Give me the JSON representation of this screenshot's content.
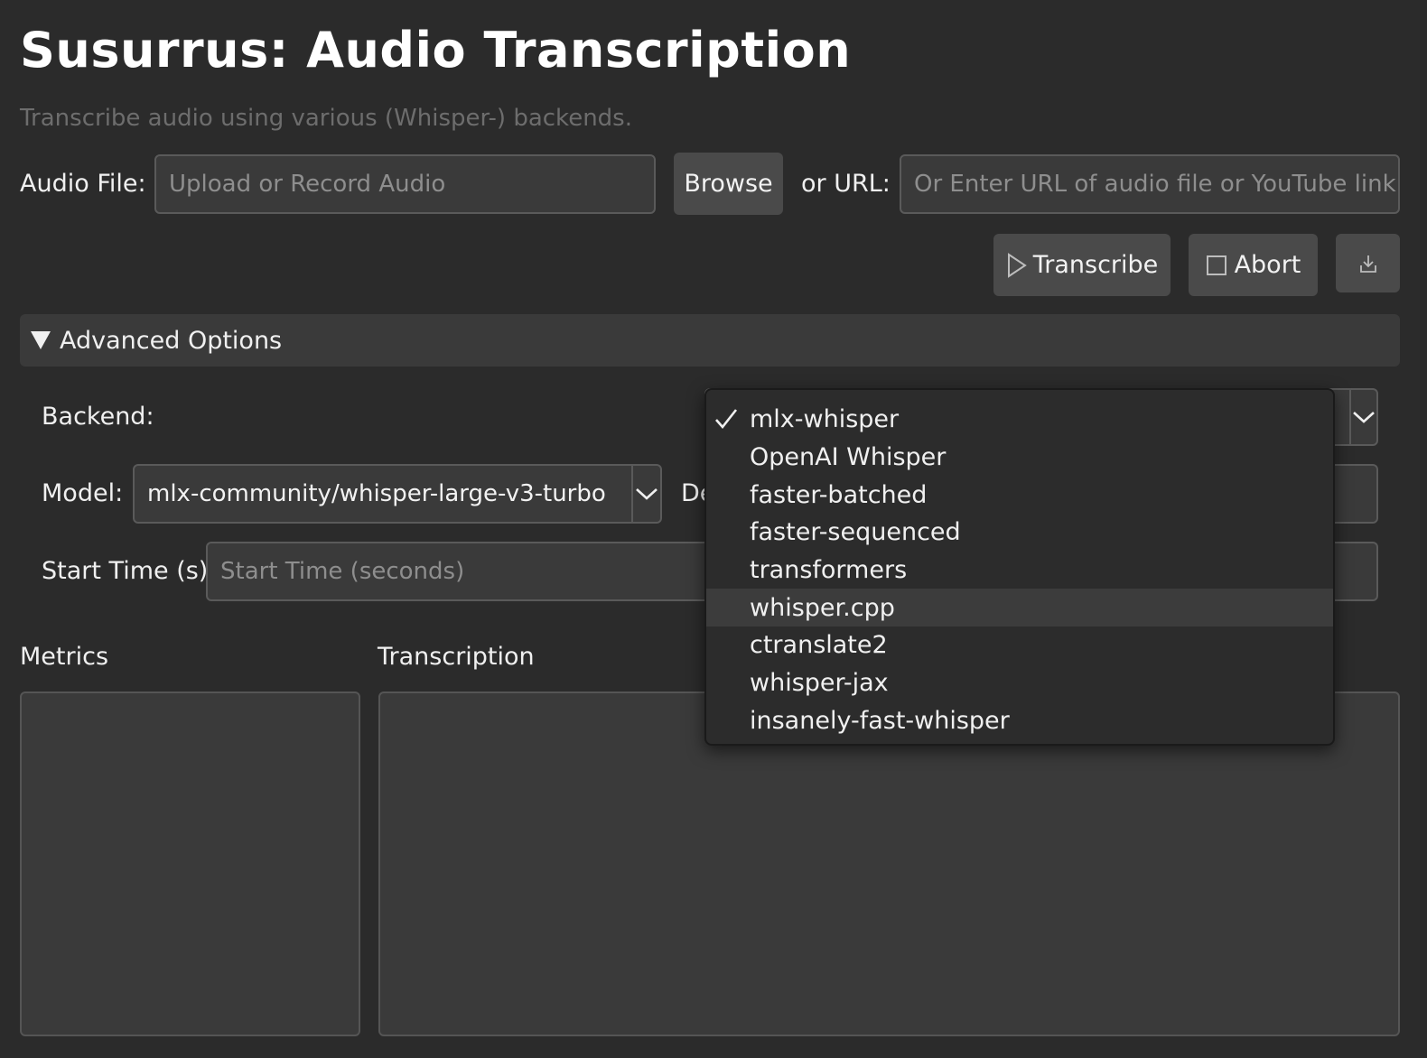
{
  "header": {
    "title": "Susurrus: Audio Transcription",
    "subtitle": "Transcribe audio using various (Whisper-) backends."
  },
  "audio": {
    "file_label": "Audio File:",
    "file_placeholder": "Upload or Record Audio",
    "browse_label": "Browse",
    "url_label": "or URL:",
    "url_placeholder": "Or Enter URL of audio file or YouTube link"
  },
  "actions": {
    "transcribe_label": "Transcribe",
    "abort_label": "Abort",
    "download_icon": "download-icon"
  },
  "advanced": {
    "section_label": "Advanced Options",
    "backend_label": "Backend:",
    "model_label": "Model:",
    "model_value": "mlx-community/whisper-large-v3-turbo",
    "device_label_partial": "De",
    "start_time_label": "Start Time (s):",
    "start_time_placeholder": "Start Time (seconds)"
  },
  "outputs": {
    "metrics_label": "Metrics",
    "transcription_label": "Transcription"
  },
  "backend_dropdown": {
    "selected": "mlx-whisper",
    "hovered": "whisper.cpp",
    "options": [
      "mlx-whisper",
      "OpenAI Whisper",
      "faster-batched",
      "faster-sequenced",
      "transformers",
      "whisper.cpp",
      "ctranslate2",
      "whisper-jax",
      "insanely-fast-whisper"
    ]
  },
  "colors": {
    "background": "#2b2b2b",
    "field_bg": "#3a3a3a",
    "button_bg": "#4a4a4a",
    "placeholder_text": "#8e8e8e"
  }
}
